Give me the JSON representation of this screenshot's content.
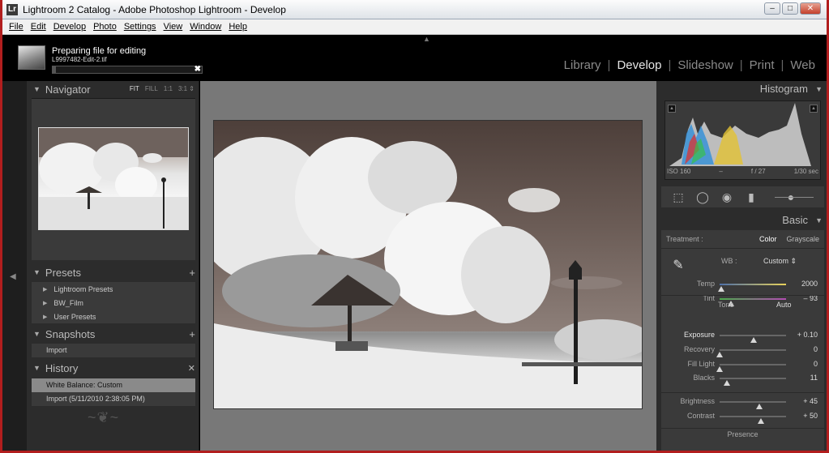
{
  "window": {
    "title": "Lightroom 2 Catalog - Adobe Photoshop Lightroom - Develop",
    "app_icon": "Lr",
    "minimize": "–",
    "maximize": "□",
    "close": "✕"
  },
  "menu": [
    "File",
    "Edit",
    "Develop",
    "Photo",
    "Settings",
    "View",
    "Window",
    "Help"
  ],
  "status": {
    "title": "Preparing file for editing",
    "file": "L9997482-Edit-2.tif",
    "close": "✖",
    "progress_fraction": 0.02
  },
  "modules": {
    "items": [
      "Library",
      "Develop",
      "Slideshow",
      "Print",
      "Web"
    ],
    "active": "Develop"
  },
  "navigator": {
    "label": "Navigator",
    "zoom": [
      "FIT",
      "FILL",
      "1:1",
      "3:1 ⇕"
    ]
  },
  "presets": {
    "label": "Presets",
    "add": "+",
    "items": [
      "Lightroom Presets",
      "BW_Film",
      "User Presets"
    ]
  },
  "snapshots": {
    "label": "Snapshots",
    "add": "+",
    "items": [
      "Import"
    ]
  },
  "history": {
    "label": "History",
    "clear": "✕",
    "items": [
      "White Balance: Custom",
      "Import (5/11/2010 2:38:05 PM)"
    ]
  },
  "histogram": {
    "label": "Histogram",
    "iso": "ISO 160",
    "focal": "–",
    "aperture": "f / 27",
    "shutter": "1/30 sec"
  },
  "basic": {
    "label": "Basic",
    "treatment_label": "Treatment :",
    "treatment_color": "Color",
    "treatment_grayscale": "Grayscale",
    "wb_label": "WB :",
    "wb_value": "Custom ⇕",
    "tone_label": "Tone",
    "auto_label": "Auto",
    "presence_label": "Presence",
    "sliders": [
      {
        "label": "Temp",
        "value": "2000",
        "fraction": 0.03
      },
      {
        "label": "Tint",
        "value": "– 93",
        "fraction": 0.17
      },
      {
        "label": "Exposure",
        "value": "+ 0.10",
        "fraction": 0.51
      },
      {
        "label": "Recovery",
        "value": "0",
        "fraction": 0.0
      },
      {
        "label": "Fill Light",
        "value": "0",
        "fraction": 0.0
      },
      {
        "label": "Blacks",
        "value": "11",
        "fraction": 0.11
      },
      {
        "label": "Brightness",
        "value": "+ 45",
        "fraction": 0.6
      },
      {
        "label": "Contrast",
        "value": "+ 50",
        "fraction": 0.62
      }
    ]
  }
}
